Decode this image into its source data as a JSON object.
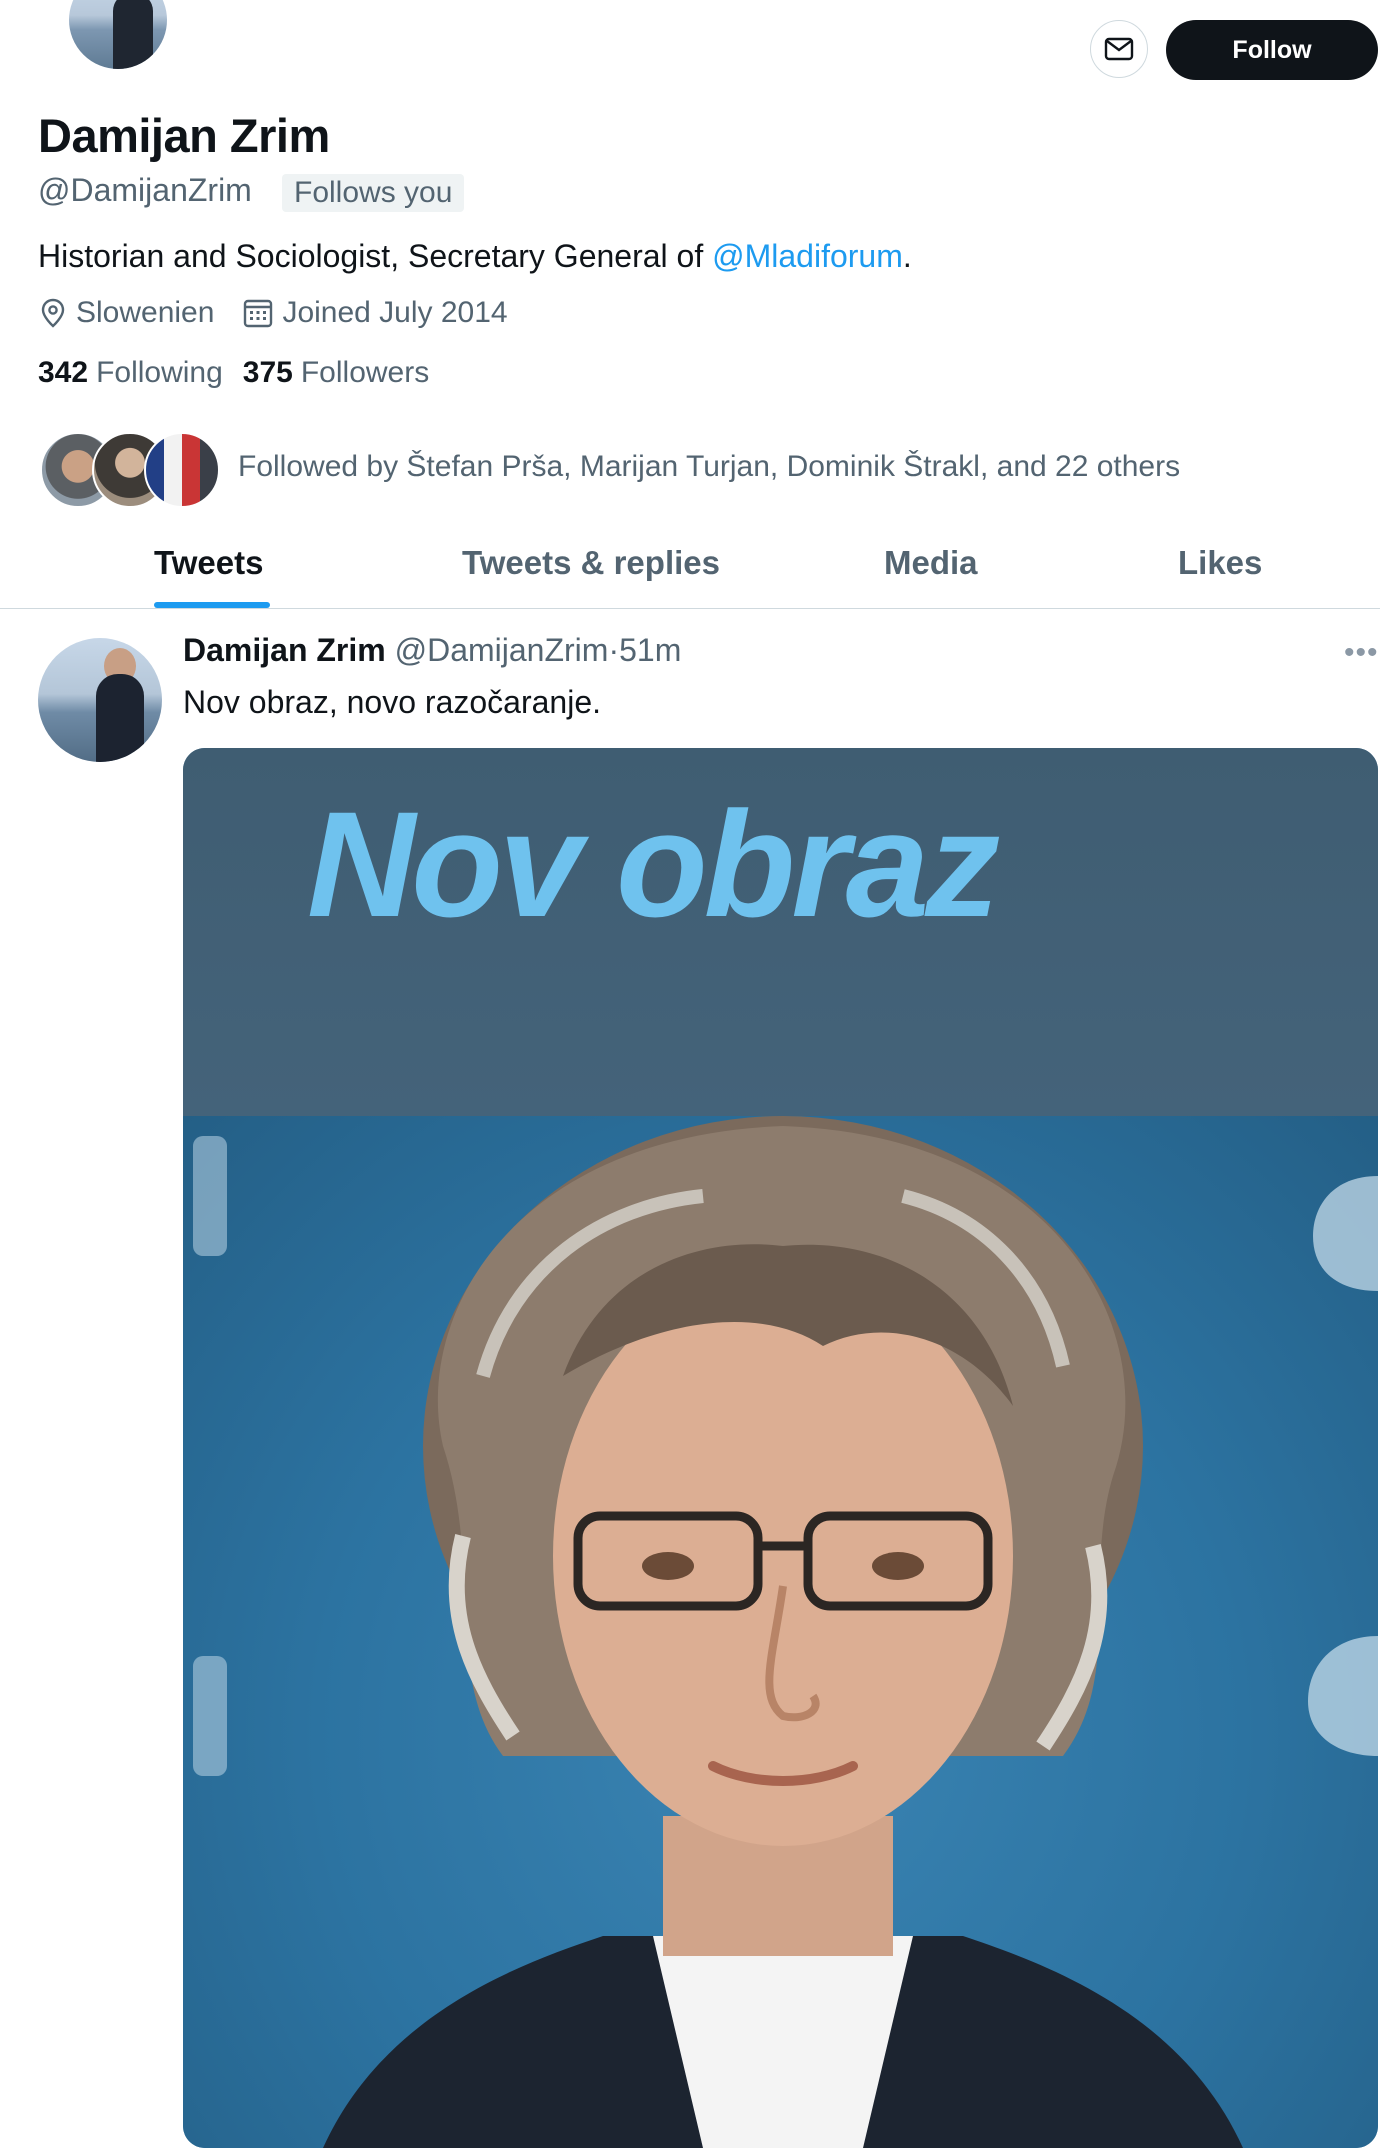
{
  "profile": {
    "display_name": "Damijan Zrim",
    "handle": "@DamijanZrim",
    "follows_you": "Follows you",
    "bio_text": "Historian and Sociologist, Secretary General of ",
    "bio_mention": "@Mladiforum",
    "bio_end": ".",
    "location": "Slowenien",
    "joined": "Joined July 2014",
    "following_count": "342",
    "following_label": "Following",
    "followers_count": "375",
    "followers_label": "Followers",
    "followed_by": "Followed by Štefan Prša, Marijan Turjan, Dominik Štrakl, and 22 others"
  },
  "actions": {
    "follow_label": "Follow",
    "message_icon": "mail-icon"
  },
  "tabs": [
    {
      "label": "Tweets",
      "active": true
    },
    {
      "label": "Tweets & replies",
      "active": false
    },
    {
      "label": "Media",
      "active": false
    },
    {
      "label": "Likes",
      "active": false
    }
  ],
  "tweet": {
    "author_name": "Damijan Zrim",
    "author_handle": "@DamijanZrim",
    "separator": "·",
    "time": "51m",
    "text": "Nov obraz, novo razočaranje.",
    "media_title": "Nov obraz"
  },
  "colors": {
    "accent": "#1d9bf0",
    "primary_button": "#0f1419",
    "muted_text": "#536471"
  }
}
